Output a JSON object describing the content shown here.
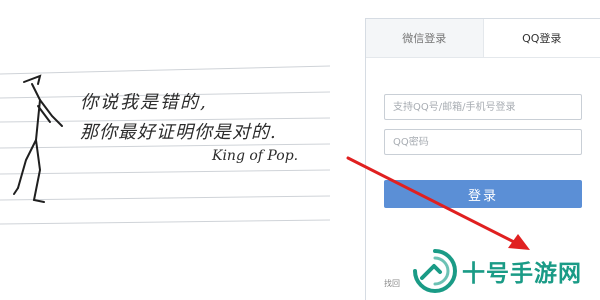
{
  "illustration": {
    "line1": "你说我是错的,",
    "line2": "那你最好证明你是对的.",
    "signature": "King of Pop."
  },
  "login": {
    "tabs": [
      {
        "label": "微信登录",
        "active": false
      },
      {
        "label": "QQ登录",
        "active": true
      }
    ],
    "username_placeholder": "支持QQ号/邮箱/手机号登录",
    "password_placeholder": "QQ密码",
    "submit_label": "登录",
    "forgot_label": "找回"
  },
  "watermark": {
    "text": "十号手游网",
    "color": "#1a9b86"
  },
  "colors": {
    "button": "#5b8fd6",
    "arrow": "#e02020",
    "panel_border": "#d6dce3"
  }
}
